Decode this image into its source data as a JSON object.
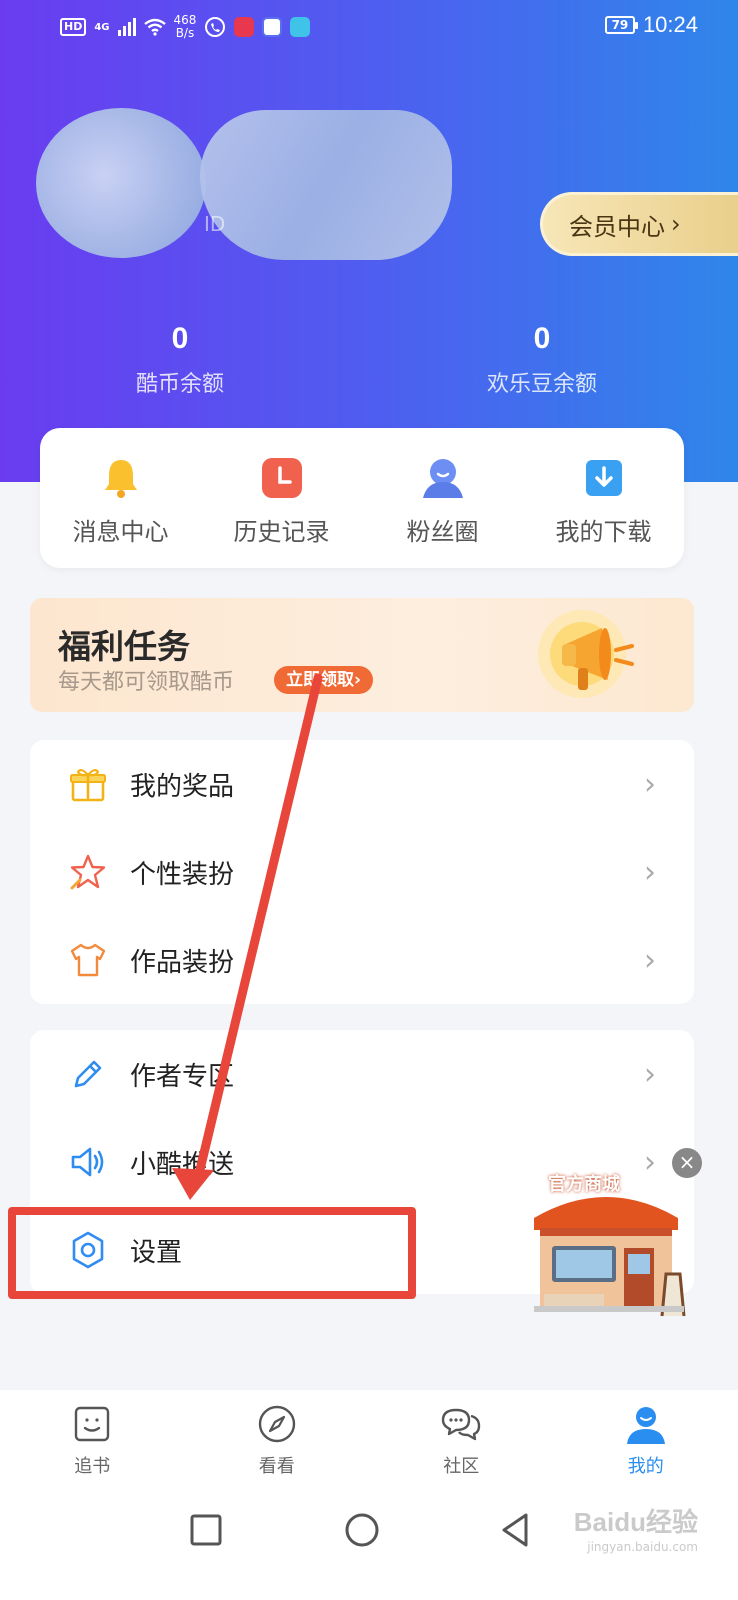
{
  "status_bar": {
    "hd": "HD",
    "network": "4G",
    "speed_value": "468",
    "speed_unit": "B/s",
    "battery": "79",
    "time": "10:24"
  },
  "profile": {
    "id_prefix": "ID",
    "vip_label": "会员中心",
    "vip_chevron": "›"
  },
  "stats": [
    {
      "value": "0",
      "label": "酷币余额"
    },
    {
      "value": "0",
      "label": "欢乐豆余额"
    }
  ],
  "quick_actions": [
    {
      "label": "消息中心",
      "icon": "bell-icon"
    },
    {
      "label": "历史记录",
      "icon": "clock-icon"
    },
    {
      "label": "粉丝圈",
      "icon": "fan-circle-icon"
    },
    {
      "label": "我的下载",
      "icon": "download-icon"
    }
  ],
  "welfare": {
    "title": "福利任务",
    "subtitle": "每天都可领取酷币",
    "button": "立即领取›"
  },
  "menu_group_1": [
    {
      "label": "我的奖品",
      "icon": "gift-icon"
    },
    {
      "label": "个性装扮",
      "icon": "star-icon"
    },
    {
      "label": "作品装扮",
      "icon": "shirt-icon"
    }
  ],
  "menu_group_2": [
    {
      "label": "作者专区",
      "icon": "pencil-icon"
    },
    {
      "label": "小酷推送",
      "icon": "speaker-icon"
    },
    {
      "label": "设置",
      "icon": "gear-icon"
    }
  ],
  "chevron": "›",
  "shop": {
    "label": "官方商城",
    "close": "×"
  },
  "bottom_nav": [
    {
      "label": "追书",
      "icon": "smile-book-icon",
      "active": false
    },
    {
      "label": "看看",
      "icon": "compass-icon",
      "active": false
    },
    {
      "label": "社区",
      "icon": "chat-icon",
      "active": false
    },
    {
      "label": "我的",
      "icon": "user-icon",
      "active": true
    }
  ],
  "watermark": {
    "text": "Baidu经验",
    "sub": "jingyan.baidu.com"
  },
  "colors": {
    "header_start": "#6a3cf0",
    "header_end": "#2f86ea",
    "accent": "#2a8ef0",
    "highlight": "#e8463a",
    "welfare_button": "#f06a35"
  }
}
